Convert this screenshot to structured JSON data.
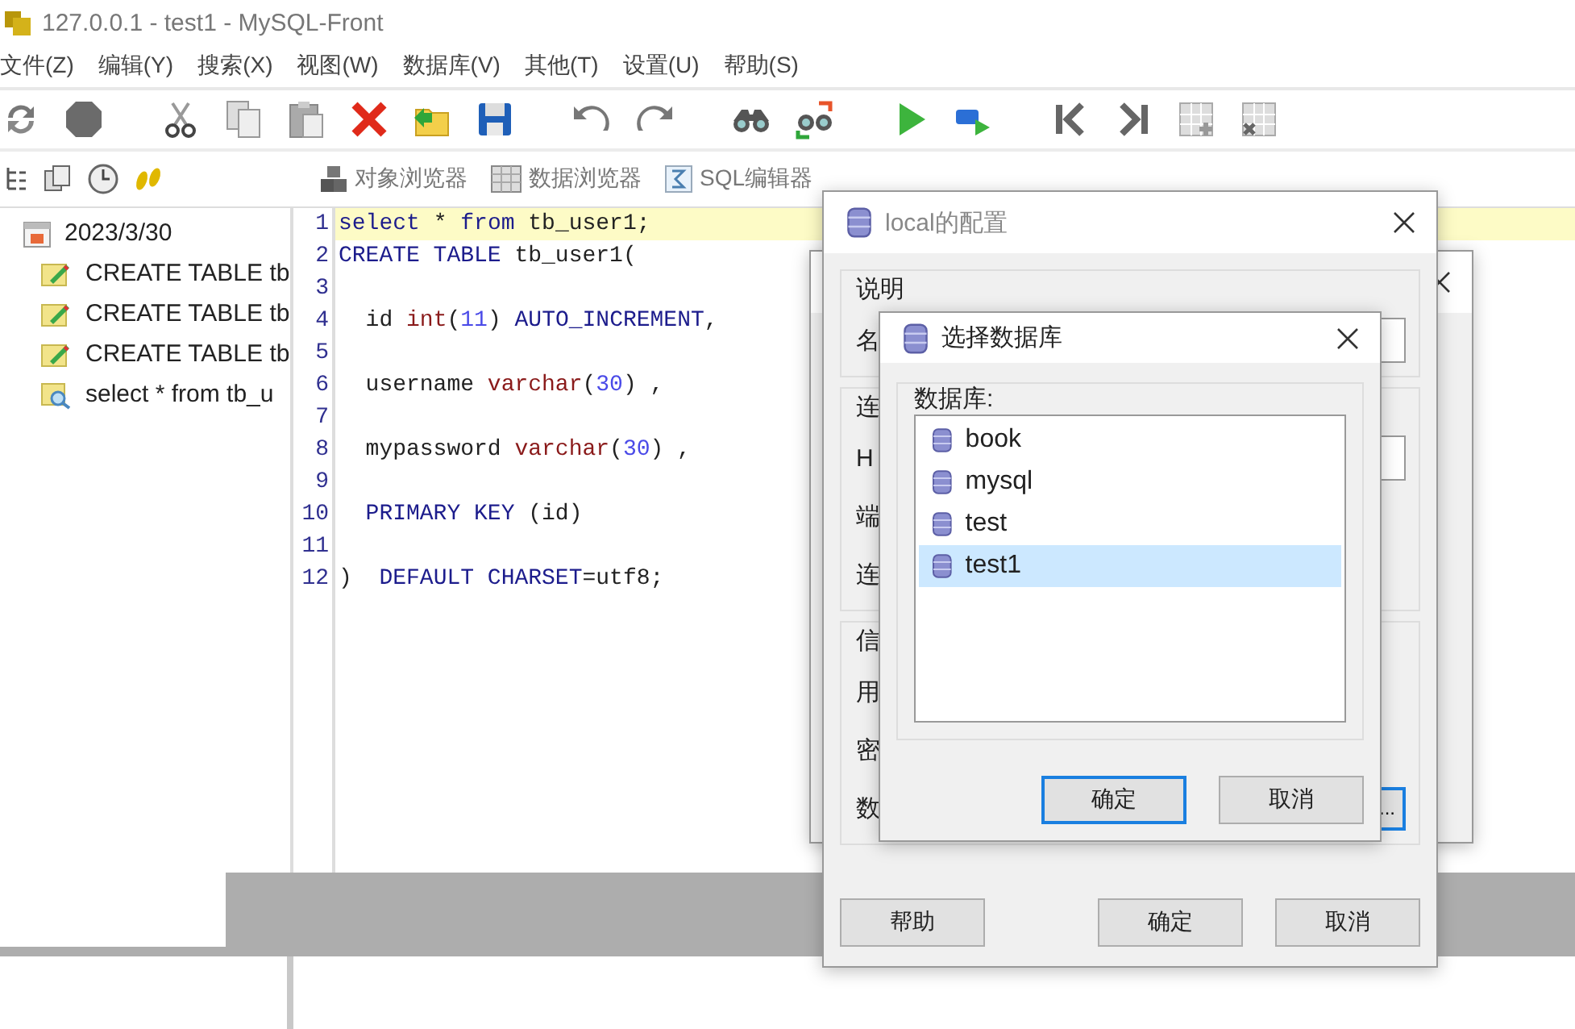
{
  "window": {
    "title": "127.0.0.1 - test1 - MySQL-Front"
  },
  "menu": [
    "文件(Z)",
    "编辑(Y)",
    "搜索(X)",
    "视图(W)",
    "数据库(V)",
    "其他(T)",
    "设置(U)",
    "帮助(S)"
  ],
  "views": [
    {
      "kind": "objects",
      "label": "对象浏览器"
    },
    {
      "kind": "data",
      "label": "数据浏览器"
    },
    {
      "kind": "sql",
      "label": "SQL编辑器"
    }
  ],
  "history": {
    "date": "2023/3/30",
    "children": [
      {
        "kind": "create",
        "text": "CREATE TABLE tb"
      },
      {
        "kind": "create",
        "text": "CREATE TABLE tb"
      },
      {
        "kind": "create",
        "text": "CREATE TABLE tb"
      },
      {
        "kind": "select",
        "text": "select * from tb_u"
      }
    ]
  },
  "editor": {
    "lines": [
      {
        "number": "1",
        "current": true,
        "tokens": [
          {
            "kind": "keyword",
            "text": "select"
          },
          {
            "kind": "plain",
            "text": " * "
          },
          {
            "kind": "keyword",
            "text": "from"
          },
          {
            "kind": "plain",
            "text": " tb_user1;"
          }
        ]
      },
      {
        "number": "2",
        "current": false,
        "tokens": [
          {
            "kind": "keyword",
            "text": "CREATE TABLE"
          },
          {
            "kind": "plain",
            "text": " tb_user1("
          }
        ]
      },
      {
        "number": "3",
        "current": false
      },
      {
        "number": "4",
        "current": false,
        "tokens": [
          {
            "kind": "plain",
            "text": "  id "
          },
          {
            "kind": "type",
            "text": "int"
          },
          {
            "kind": "plain",
            "text": "("
          },
          {
            "kind": "number",
            "text": "11"
          },
          {
            "kind": "plain",
            "text": ") "
          },
          {
            "kind": "keyword",
            "text": "AUTO_INCREMENT"
          },
          {
            "kind": "plain",
            "text": ","
          }
        ]
      },
      {
        "number": "5",
        "current": false
      },
      {
        "number": "6",
        "current": false,
        "tokens": [
          {
            "kind": "plain",
            "text": "  username "
          },
          {
            "kind": "type",
            "text": "varchar"
          },
          {
            "kind": "plain",
            "text": "("
          },
          {
            "kind": "number",
            "text": "30"
          },
          {
            "kind": "plain",
            "text": ") ,"
          }
        ]
      },
      {
        "number": "7",
        "current": false
      },
      {
        "number": "8",
        "current": false,
        "tokens": [
          {
            "kind": "plain",
            "text": "  mypassword "
          },
          {
            "kind": "type",
            "text": "varchar"
          },
          {
            "kind": "plain",
            "text": "("
          },
          {
            "kind": "number",
            "text": "30"
          },
          {
            "kind": "plain",
            "text": ") ,"
          }
        ]
      },
      {
        "number": "9",
        "current": false
      },
      {
        "number": "10",
        "current": false,
        "tokens": [
          {
            "kind": "keyword",
            "text": "  PRIMARY KEY"
          },
          {
            "kind": "plain",
            "text": " (id)"
          }
        ]
      },
      {
        "number": "11",
        "current": false
      },
      {
        "number": "12",
        "current": false,
        "tokens": [
          {
            "kind": "plain",
            "text": ")  "
          },
          {
            "kind": "keyword",
            "text": "DEFAULT CHARSET"
          },
          {
            "kind": "plain",
            "text": "=utf8;"
          }
        ]
      }
    ]
  },
  "config_dialog": {
    "title": "local的配置",
    "groups": [
      {
        "caption": "说明",
        "rows": [
          {
            "kind": "field",
            "label": "名"
          }
        ]
      },
      {
        "caption": "连",
        "rows": [
          {
            "kind": "field",
            "label": "H"
          },
          {
            "kind": "label",
            "label": "端"
          },
          {
            "kind": "label",
            "label": "连"
          }
        ]
      },
      {
        "caption": "信",
        "rows": [
          {
            "kind": "label",
            "label": "用"
          },
          {
            "kind": "label",
            "label": "密"
          },
          {
            "kind": "browse",
            "label": "数",
            "button": "..."
          }
        ]
      }
    ],
    "buttons": [
      "帮助",
      "确定",
      "取消"
    ]
  },
  "select_dialog": {
    "title": "选择数据库",
    "group_label": "数据库:",
    "databases": [
      {
        "name": "book",
        "selected": false
      },
      {
        "name": "mysql",
        "selected": false
      },
      {
        "name": "test",
        "selected": false
      },
      {
        "name": "test1",
        "selected": true
      }
    ],
    "buttons": [
      {
        "label": "确定",
        "default": true
      },
      {
        "label": "取消",
        "default": false
      }
    ]
  }
}
